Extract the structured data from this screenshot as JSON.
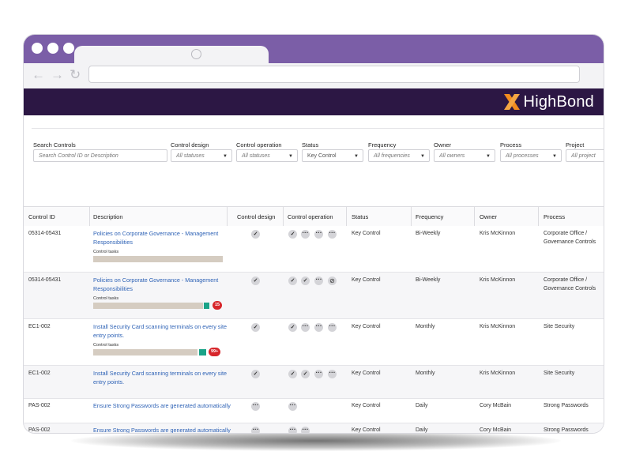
{
  "browser": {
    "back_icon": "←",
    "forward_icon": "→",
    "reload_icon": "↻"
  },
  "app": {
    "brand": "HighBond"
  },
  "filters": {
    "search": {
      "label": "Search Controls",
      "placeholder": "Search Control ID or Description"
    },
    "control_design": {
      "label": "Control design",
      "value": "All statuses"
    },
    "control_operation": {
      "label": "Control operation",
      "value": "All statuses"
    },
    "status": {
      "label": "Status",
      "value": "Key Control"
    },
    "frequency": {
      "label": "Frequency",
      "value": "All frequencies"
    },
    "owner": {
      "label": "Owner",
      "value": "All owners"
    },
    "process": {
      "label": "Process",
      "value": "All processes"
    },
    "project": {
      "label": "Project",
      "value": "All project"
    }
  },
  "table": {
    "headers": {
      "control_id": "Control ID",
      "description": "Description",
      "control_design": "Control design",
      "control_operation": "Control operation",
      "status": "Status",
      "frequency": "Frequency",
      "owner": "Owner",
      "process": "Process"
    },
    "control_tasks_label": "Control tasks",
    "rows": [
      {
        "id": "05314-05431",
        "desc": "Policies on Corporate Governance - Management Responsibilities",
        "status": "Key Control",
        "frequency": "Bi-Weekly",
        "owner": "Kris McKinnon",
        "process": "Corporate Office / Governance Controls"
      },
      {
        "id": "05314-05431",
        "desc": "Policies on Corporate Governance - Management Responsibilities",
        "status": "Key Control",
        "frequency": "Bi-Weekly",
        "owner": "Kris McKinnon",
        "process": "Corporate Office / Governance Controls",
        "badge": "15"
      },
      {
        "id": "EC1-002",
        "desc": "Install Security Card scanning terminals on every site entry points.",
        "status": "Key Control",
        "frequency": "Monthly",
        "owner": "Kris McKinnon",
        "process": "Site Security",
        "badge": "99+"
      },
      {
        "id": "EC1-002",
        "desc": "Install Security Card scanning terminals on every site entry points.",
        "status": "Key Control",
        "frequency": "Monthly",
        "owner": "Kris McKinnon",
        "process": "Site Security"
      },
      {
        "id": "PAS-002",
        "desc": "Ensure Strong Passwords are generated automatically",
        "status": "Key Control",
        "frequency": "Daily",
        "owner": "Cory McBain",
        "process": "Strong Passwords"
      },
      {
        "id": "PAS-002",
        "desc": "Ensure Strong Passwords are generated automatically",
        "status": "Key Control",
        "frequency": "Daily",
        "owner": "Cory McBain",
        "process": "Strong Passwords"
      }
    ]
  },
  "icons": {
    "check": "✓",
    "more": "···",
    "blocked": "⊘"
  },
  "colors": {
    "chrome": "#7b5ea7",
    "app_bar": "#2c1744",
    "logo_orange": "#f28c1e",
    "link": "#2f63b6",
    "progress_teal": "#1aa388",
    "badge_red": "#d7262b"
  }
}
